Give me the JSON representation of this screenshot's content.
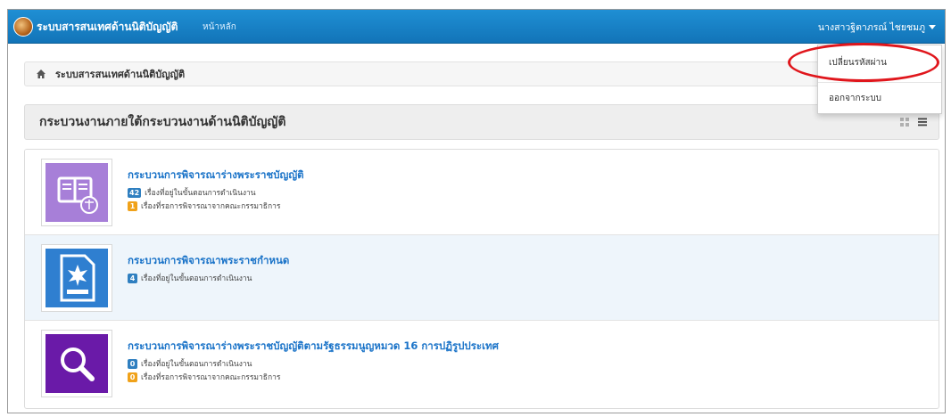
{
  "navbar": {
    "brand": "ระบบสารสนเทศด้านนิติบัญญัติ",
    "home_link": "หน้าหลัก",
    "user_name": "นางสาวฐิตาภรณ์ ไชยชมภู"
  },
  "dropdown": {
    "change_password": "เปลี่ยนรหัสผ่าน",
    "logout": "ออกจากระบบ"
  },
  "breadcrumb": {
    "text": "ระบบสารสนเทศด้านนิติบัญญัติ"
  },
  "section": {
    "title": "กระบวนงานภายใต้กระบวนงานด้านนิติบัญญัติ"
  },
  "rows": [
    {
      "title": "กระบวนการพิจารณาร่างพระราชบัญญัติ",
      "lines": [
        {
          "count": "42",
          "text": "เรื่องที่อยู่ในขั้นตอนการดำเนินงาน",
          "color": "blue"
        },
        {
          "count": "1",
          "text": "เรื่องที่รอการพิจารณาจากคณะกรรมาธิการ",
          "color": "orange"
        }
      ]
    },
    {
      "title": "กระบวนการพิจารณาพระราชกำหนด",
      "lines": [
        {
          "count": "4",
          "text": "เรื่องที่อยู่ในขั้นตอนการดำเนินงาน",
          "color": "blue"
        }
      ]
    },
    {
      "title": "กระบวนการพิจารณาร่างพระราชบัญญัติตามรัฐธรรมนูญหมวด 16 การปฏิรูปประเทศ",
      "lines": [
        {
          "count": "0",
          "text": "เรื่องที่อยู่ในขั้นตอนการดำเนินงาน",
          "color": "blue"
        },
        {
          "count": "0",
          "text": "เรื่องที่รอการพิจารณาจากคณะกรรมาธิการ",
          "color": "orange"
        }
      ]
    }
  ],
  "colors": {
    "navbar": "#1a84c8",
    "link": "#1a73c8",
    "badge_blue": "#2f7fc0",
    "badge_orange": "#f0a21a",
    "highlight": "#e0161c",
    "thumb1": "#a77fd8",
    "thumb2": "#2f7fd0",
    "thumb3": "#6a1aa8"
  },
  "icons": {
    "row1": "book-scale-icon",
    "row2": "document-decree-icon",
    "row3": "magnifier-icon"
  }
}
